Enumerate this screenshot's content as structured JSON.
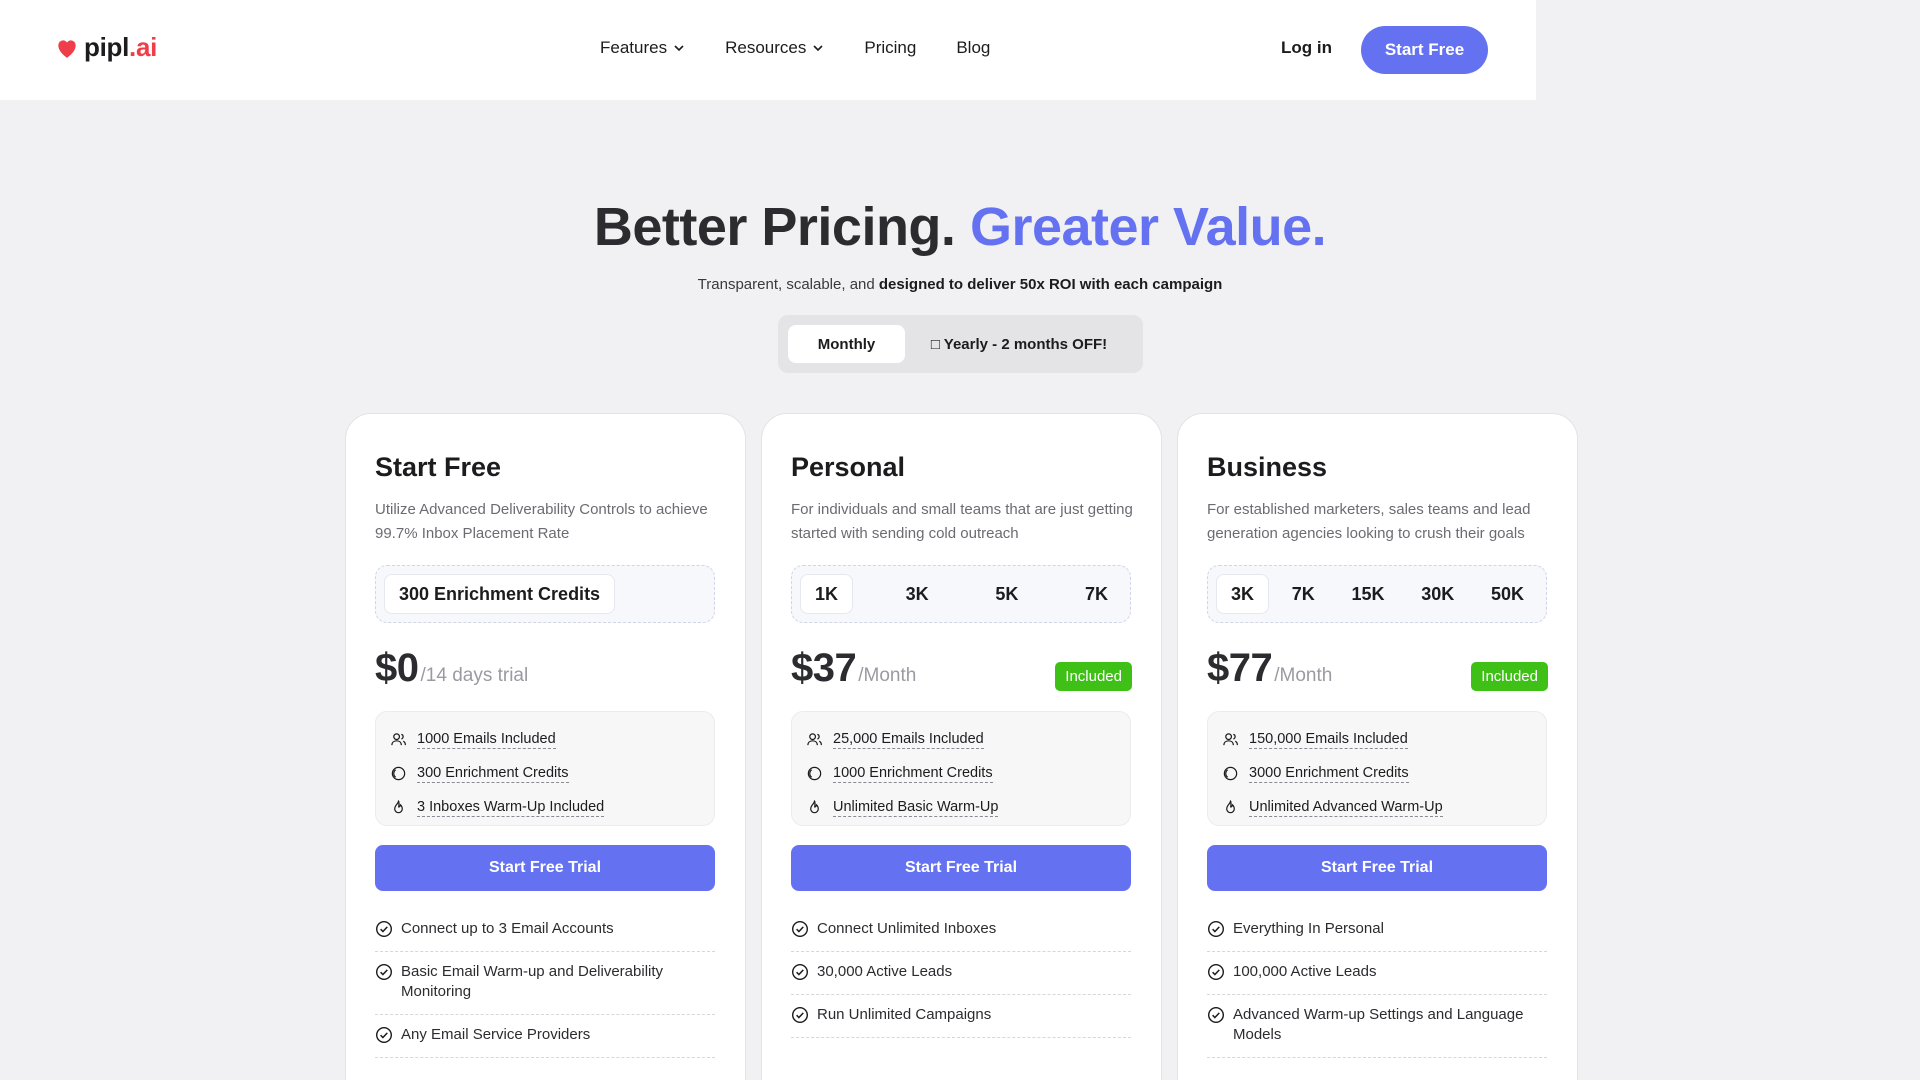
{
  "brand": {
    "name_main": "pipl",
    "name_suffix": ".ai"
  },
  "nav": {
    "items": [
      {
        "label": "Features",
        "dropdown": true
      },
      {
        "label": "Resources",
        "dropdown": true
      },
      {
        "label": "Pricing",
        "dropdown": false
      },
      {
        "label": "Blog",
        "dropdown": false
      }
    ],
    "login": "Log in",
    "cta": "Start Free"
  },
  "hero": {
    "title_main": "Better Pricing.",
    "title_accent": "Greater Value.",
    "subtitle_plain": "Transparent, scalable, and ",
    "subtitle_bold": "designed to deliver 50x ROI with each campaign"
  },
  "billing": {
    "monthly": "Monthly",
    "yearly": "□ Yearly - 2 months OFF!",
    "selected": "Monthly"
  },
  "colors": {
    "accent": "#6472f2",
    "brand_red": "#ef3e4a",
    "badge_green": "#3fc017"
  },
  "plans": [
    {
      "name": "Start Free",
      "description": "Utilize Advanced Deliverability Controls to achieve 99.7% Inbox Placement Rate",
      "credit_options": [
        "300 Enrichment Credits"
      ],
      "selected_credit": "300 Enrichment Credits",
      "price": "$0",
      "period": "/14 days trial",
      "badge": "",
      "included": [
        "1000 Emails Included",
        "300 Enrichment Credits",
        "3 Inboxes Warm-Up Included"
      ],
      "cta": "Start Free Trial",
      "features": [
        "Connect up to 3 Email Accounts",
        "Basic Email Warm-up and Deliverability Monitoring",
        "Any Email Service Providers"
      ]
    },
    {
      "name": "Personal",
      "description": "For individuals and small teams that are just getting started with sending cold outreach",
      "credit_options": [
        "1K",
        "3K",
        "5K",
        "7K"
      ],
      "selected_credit": "1K",
      "price": "$37",
      "period": "/Month",
      "badge": "Included",
      "included": [
        "25,000 Emails Included",
        "1000 Enrichment Credits",
        "Unlimited Basic Warm-Up"
      ],
      "cta": "Start Free Trial",
      "features": [
        "Connect Unlimited Inboxes",
        "30,000 Active Leads",
        "Run Unlimited Campaigns"
      ]
    },
    {
      "name": "Business",
      "description": "For established marketers, sales teams and lead generation agencies looking to crush their goals",
      "credit_options": [
        "3K",
        "7K",
        "15K",
        "30K",
        "50K"
      ],
      "selected_credit": "3K",
      "price": "$77",
      "period": "/Month",
      "badge": "Included",
      "included": [
        "150,000 Emails Included",
        "3000 Enrichment Credits",
        "Unlimited Advanced Warm-Up"
      ],
      "cta": "Start Free Trial",
      "features": [
        "Everything In Personal",
        "100,000 Active Leads",
        "Advanced Warm-up Settings and Language Models"
      ]
    }
  ]
}
